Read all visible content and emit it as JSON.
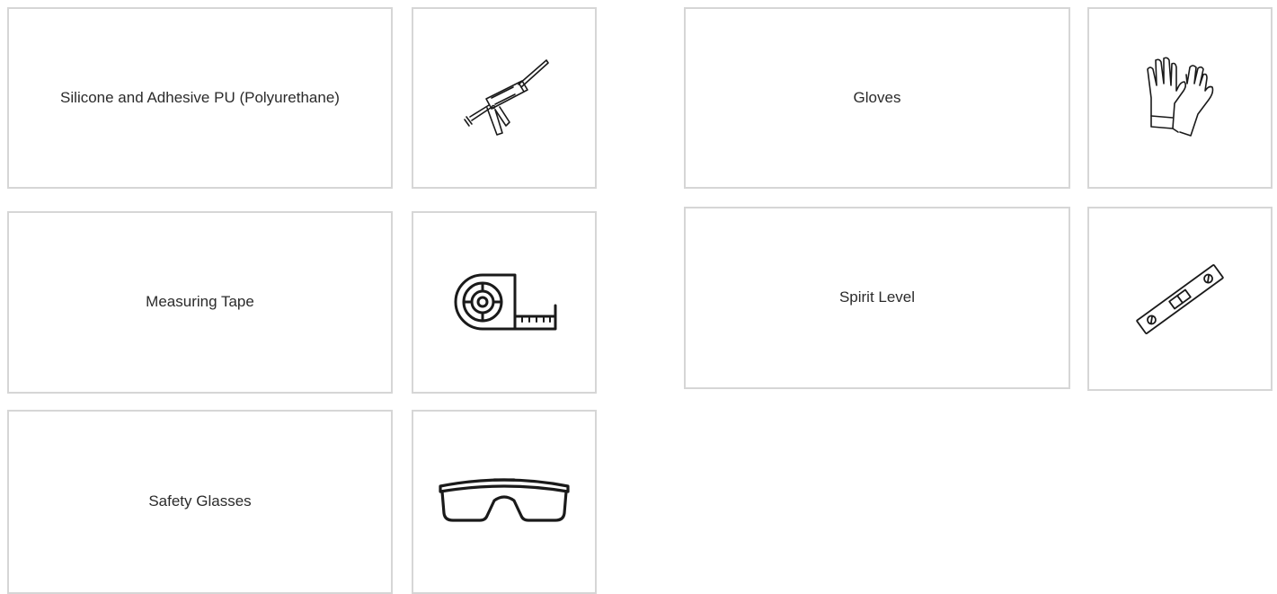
{
  "items": [
    {
      "label": "Silicone and Adhesive PU (Polyurethane)",
      "icon": "caulking-gun-icon"
    },
    {
      "label": "Measuring Tape",
      "icon": "measuring-tape-icon"
    },
    {
      "label": "Safety Glasses",
      "icon": "safety-glasses-icon"
    },
    {
      "label": "Gloves",
      "icon": "gloves-icon"
    },
    {
      "label": "Spirit Level",
      "icon": "spirit-level-icon"
    }
  ],
  "colors": {
    "border": "#d6d6d6",
    "text": "#2b2b2b",
    "icon_stroke": "#1a1a1a",
    "background": "#ffffff"
  }
}
